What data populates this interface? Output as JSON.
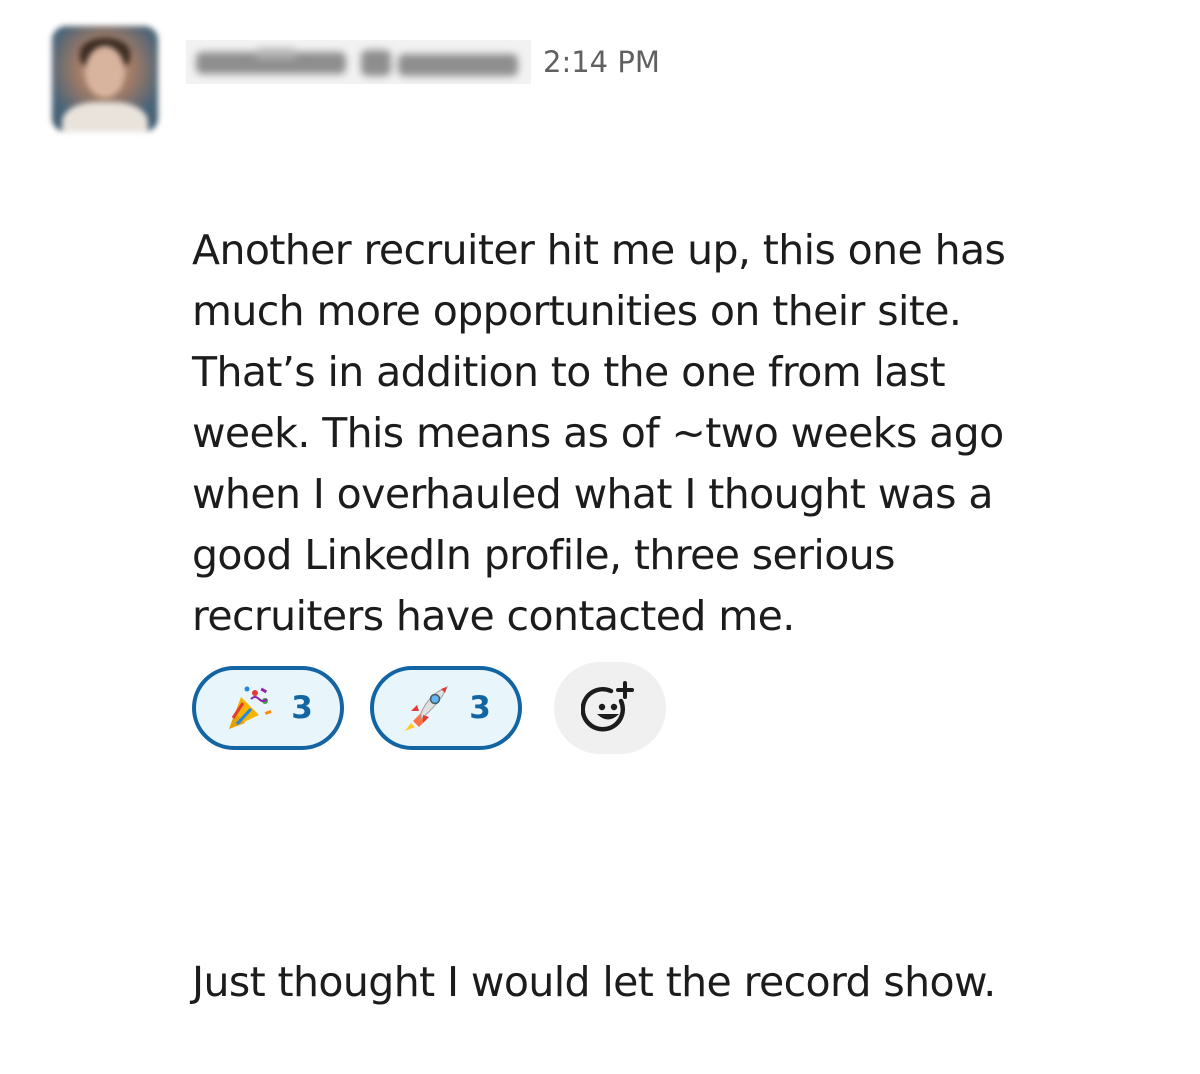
{
  "message": {
    "timestamp": "2:14 PM",
    "paragraphs": [
      "Another recruiter hit me up, this one has\nmuch more opportunities on their site.\nThat’s in addition to the one from last\nweek. This means as of ~two weeks ago\nwhen I overhauled what I thought was a\ngood LinkedIn profile, three serious\nrecruiters have contacted me.",
      "Just thought I would let the record show."
    ]
  },
  "reactions": [
    {
      "icon": "party-popper-icon",
      "count": "3"
    },
    {
      "icon": "rocket-icon",
      "count": "3"
    }
  ],
  "add_reaction": {
    "icon": "add-reaction-icon"
  },
  "colors": {
    "reaction_border": "#1264a3",
    "reaction_bg": "#e8f5fa",
    "text": "#1d1c1d",
    "timestamp": "#616061"
  }
}
